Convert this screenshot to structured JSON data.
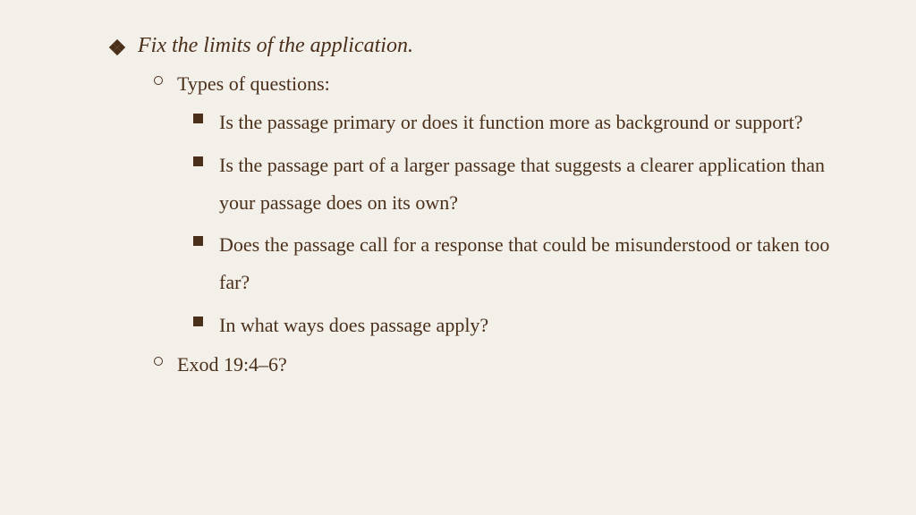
{
  "heading": "Fix the limits of the application.",
  "sub1_label": "Types of questions:",
  "questions": [
    "Is the passage primary or does it function more as background or support?",
    "Is the passage part of a larger passage that suggests a clearer application than your passage does on its own?",
    "Does the passage call for a response that could be misunderstood or taken too far?",
    "In what ways does passage apply?"
  ],
  "sub2_label": "Exod 19:4–6?"
}
